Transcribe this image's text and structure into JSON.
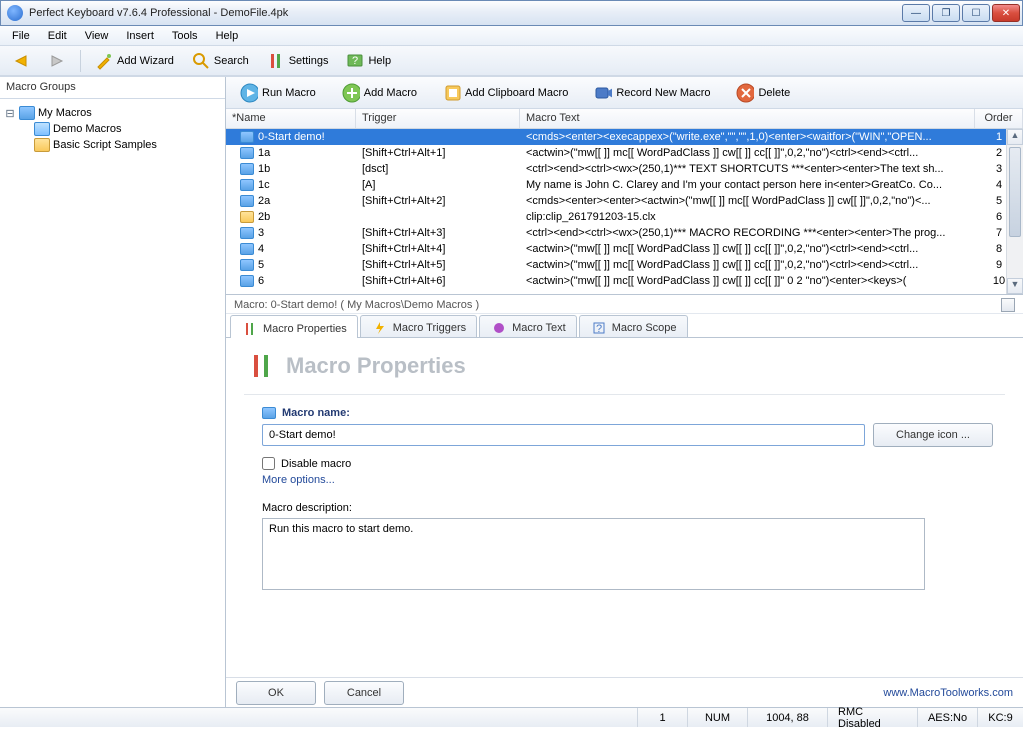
{
  "window": {
    "title": "Perfect Keyboard v7.6.4 Professional - DemoFile.4pk"
  },
  "menu": [
    "File",
    "Edit",
    "View",
    "Insert",
    "Tools",
    "Help"
  ],
  "toolbar": {
    "addwizard": "Add Wizard",
    "search": "Search",
    "settings": "Settings",
    "help": "Help"
  },
  "sidebar": {
    "title": "Macro Groups",
    "root": "My Macros",
    "items": [
      "Demo Macros",
      "Basic Script Samples"
    ]
  },
  "actionbar": {
    "run": "Run Macro",
    "add": "Add Macro",
    "addclip": "Add Clipboard Macro",
    "record": "Record New Macro",
    "delete": "Delete"
  },
  "table": {
    "headers": {
      "name": "*Name",
      "trigger": "Trigger",
      "text": "Macro Text",
      "order": "Order"
    },
    "rows": [
      {
        "name": "0-Start demo!",
        "trigger": "",
        "text": "<cmds><enter><execappex>(\"write.exe\",\"\",\"\",1,0)<enter><waitfor>(\"WIN\",\"OPEN...",
        "order": 1,
        "selected": true,
        "icon": "box"
      },
      {
        "name": "1a",
        "trigger": "[Shift+Ctrl+Alt+1]",
        "text": "<actwin>(\"mw[[  ]] mc[[ WordPadClass ]] cw[[  ]] cc[[  ]]\",0,2,\"no\")<ctrl><end><ctrl...",
        "order": 2,
        "icon": "box"
      },
      {
        "name": "1b",
        "trigger": "[dsct]",
        "text": "<ctrl><end><ctrl><wx>(250,1)*** TEXT SHORTCUTS ***<enter><enter>The text sh...",
        "order": 3,
        "icon": "box"
      },
      {
        "name": "1c",
        "trigger": "[A]",
        "text": "My name is John C. Clarey and I'm your contact person here in<enter>GreatCo. Co...",
        "order": 4,
        "icon": "box"
      },
      {
        "name": "2a",
        "trigger": "[Shift+Ctrl+Alt+2]",
        "text": "<cmds><enter><enter><actwin>(\"mw[[  ]] mc[[ WordPadClass ]] cw[[  ]]\",0,2,\"no\")<...",
        "order": 5,
        "icon": "box"
      },
      {
        "name": "2b",
        "trigger": "",
        "text": "clip:clip_261791203-15.clx",
        "order": 6,
        "icon": "clip"
      },
      {
        "name": "3",
        "trigger": "[Shift+Ctrl+Alt+3]",
        "text": "<ctrl><end><ctrl><wx>(250,1)*** MACRO RECORDING ***<enter><enter>The prog...",
        "order": 7,
        "icon": "box"
      },
      {
        "name": "4",
        "trigger": "[Shift+Ctrl+Alt+4]",
        "text": "<actwin>(\"mw[[  ]] mc[[ WordPadClass ]] cw[[  ]] cc[[  ]]\",0,2,\"no\")<ctrl><end><ctrl...",
        "order": 8,
        "icon": "box"
      },
      {
        "name": "5",
        "trigger": "[Shift+Ctrl+Alt+5]",
        "text": "<actwin>(\"mw[[  ]] mc[[ WordPadClass ]] cw[[  ]] cc[[  ]]\",0,2,\"no\")<ctrl><end><ctrl...",
        "order": 9,
        "icon": "box"
      },
      {
        "name": "6",
        "trigger": "[Shift+Ctrl+Alt+6]",
        "text": "<actwin>(\"mw[[  ]] mc[[ WordPadClass ]] cw[[  ]] cc[[  ]]\" 0 2 \"no\")<enter><keys>(",
        "order": 10,
        "icon": "box"
      }
    ]
  },
  "details": {
    "path": "Macro: 0-Start demo! ( My Macros\\Demo Macros )",
    "tabs": [
      "Macro Properties",
      "Macro Triggers",
      "Macro Text",
      "Macro Scope"
    ],
    "heading": "Macro Properties",
    "macroNameLabel": "Macro name:",
    "macroName": "0-Start demo!",
    "changeIcon": "Change icon ...",
    "disableMacro": "Disable macro",
    "moreOptions": "More options...",
    "descLabel": "Macro description:",
    "descValue": "Run this macro to start demo.",
    "ok": "OK",
    "cancel": "Cancel",
    "site": "www.MacroToolworks.com"
  },
  "statusbar": {
    "col1": "1",
    "col2": "NUM",
    "col3": "1004, 88",
    "col4": "RMC Disabled",
    "col5": "AES:No",
    "col6": "KC:9"
  }
}
